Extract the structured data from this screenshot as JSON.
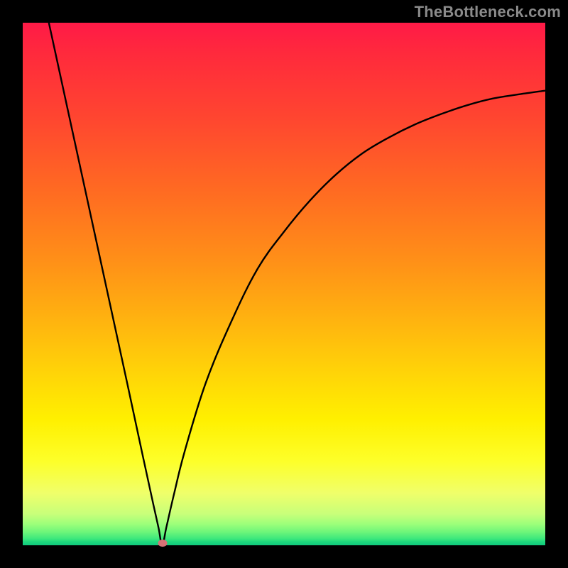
{
  "watermark": "TheBottleneck.com",
  "colors": {
    "frame": "#000000",
    "curve": "#000000",
    "marker": "#d77276",
    "watermark": "#8a8a8a"
  },
  "chart_data": {
    "type": "line",
    "title": "",
    "xlabel": "",
    "ylabel": "",
    "xlim": [
      0,
      1
    ],
    "ylim": [
      0,
      1
    ],
    "minimum_x": 0.267,
    "marker": {
      "x": 0.267,
      "y": 0.004
    },
    "series": [
      {
        "name": "bottleneck-curve",
        "x": [
          0.05,
          0.1,
          0.15,
          0.2,
          0.23,
          0.25,
          0.26,
          0.267,
          0.275,
          0.29,
          0.31,
          0.35,
          0.4,
          0.45,
          0.5,
          0.55,
          0.6,
          0.65,
          0.7,
          0.75,
          0.8,
          0.85,
          0.9,
          0.95,
          1.0
        ],
        "y": [
          1.0,
          0.77,
          0.54,
          0.31,
          0.17,
          0.078,
          0.033,
          0.0,
          0.035,
          0.1,
          0.18,
          0.31,
          0.43,
          0.53,
          0.6,
          0.66,
          0.71,
          0.75,
          0.78,
          0.805,
          0.825,
          0.842,
          0.855,
          0.863,
          0.87
        ]
      }
    ]
  }
}
